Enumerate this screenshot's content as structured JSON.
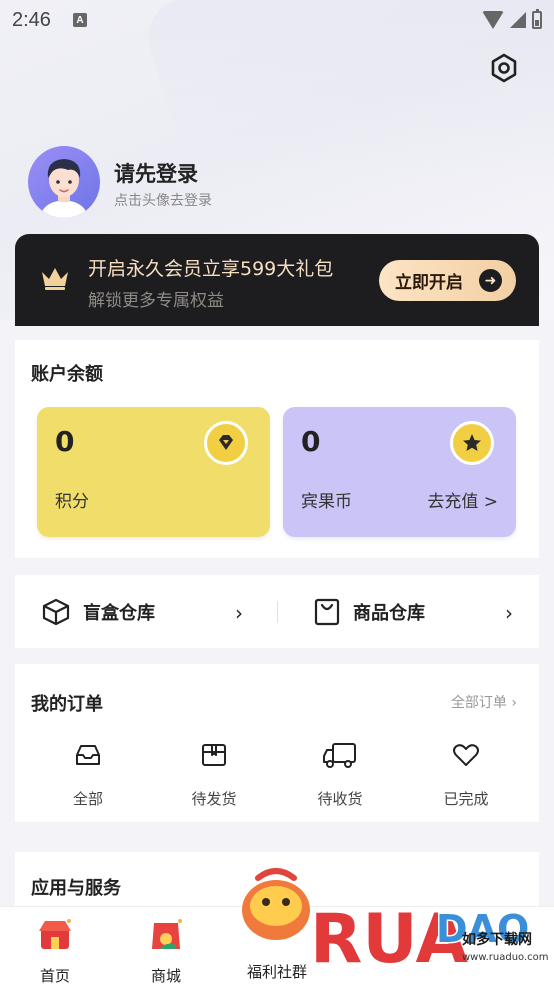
{
  "status_bar": {
    "time": "2:46",
    "notification_badge": "A"
  },
  "profile": {
    "title": "请先登录",
    "subtitle": "点击头像去登录"
  },
  "vip_banner": {
    "title": "开启永久会员立享599大礼包",
    "subtitle": "解锁更多专属权益",
    "button_label": "立即开启",
    "button_arrow": "➜"
  },
  "balance": {
    "title": "账户余额",
    "points": {
      "value": "0",
      "label": "积分"
    },
    "coins": {
      "value": "0",
      "label": "宾果币",
      "link": "去充值 >"
    }
  },
  "warehouse": {
    "blindbox_label": "盲盒仓库",
    "goods_label": "商品仓库",
    "chevron": "›"
  },
  "orders": {
    "title": "我的订单",
    "all_link": "全部订单 ›",
    "items": [
      {
        "label": "全部",
        "icon": "inbox-icon"
      },
      {
        "label": "待发货",
        "icon": "package-icon"
      },
      {
        "label": "待收货",
        "icon": "truck-icon"
      },
      {
        "label": "已完成",
        "icon": "heart-icon"
      }
    ]
  },
  "services": {
    "title": "应用与服务"
  },
  "bottom_nav": {
    "items": [
      {
        "label": "首页",
        "icon": "home-shop-icon"
      },
      {
        "label": "商城",
        "icon": "mall-bag-icon"
      },
      {
        "label": "福利社群",
        "icon": "community-icon"
      }
    ]
  },
  "watermark": {
    "brand": "RUANDAO",
    "tagline": "如多下载网",
    "url": "www.ruaduo.com"
  },
  "colors": {
    "vip_bg": "#1d1c1f",
    "vip_gold": "#f6dfc0",
    "points_tile": "#f1de6a",
    "coins_tile": "#cbc4f6",
    "badge_yellow": "#f2cf42"
  }
}
